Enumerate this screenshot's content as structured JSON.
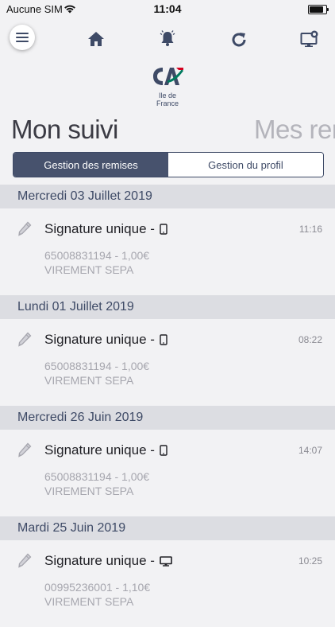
{
  "status_bar": {
    "carrier": "Aucune SIM",
    "time": "11:04",
    "battery_level": 0.85
  },
  "nav": {
    "icons": [
      "menu-icon",
      "home-icon",
      "bell-icon",
      "refresh-icon",
      "monitor-icon"
    ]
  },
  "logo": {
    "line1": "Ile de",
    "line2": "France"
  },
  "headline": {
    "current": "Mon suivi",
    "next": "Mes remises"
  },
  "segment": {
    "active_label": "Gestion des remises",
    "inactive_label": "Gestion du profil"
  },
  "colors": {
    "brand_dark": "#3e4a66",
    "brand_green": "#007a5e",
    "brand_red": "#d4001e",
    "header_bg": "#dcdde2",
    "page_bg": "#f2f2f4"
  },
  "groups": [
    {
      "date": "Mercredi 03 Juillet 2019",
      "entry": {
        "title": "Signature unique -",
        "device": "phone-icon",
        "time": "11:16",
        "ref": "65008831194 - 1,00€",
        "type": "VIREMENT SEPA"
      }
    },
    {
      "date": "Lundi 01 Juillet 2019",
      "entry": {
        "title": "Signature unique -",
        "device": "phone-icon",
        "time": "08:22",
        "ref": "65008831194 - 1,00€",
        "type": "VIREMENT SEPA"
      }
    },
    {
      "date": "Mercredi 26 Juin 2019",
      "entry": {
        "title": "Signature unique -",
        "device": "phone-icon",
        "time": "14:07",
        "ref": "65008831194 - 1,00€",
        "type": "VIREMENT SEPA"
      }
    },
    {
      "date": "Mardi 25 Juin 2019",
      "entry": {
        "title": "Signature unique -",
        "device": "desktop-icon",
        "time": "10:25",
        "ref": "00995236001 - 1,10€",
        "type": "VIREMENT SEPA"
      }
    }
  ]
}
